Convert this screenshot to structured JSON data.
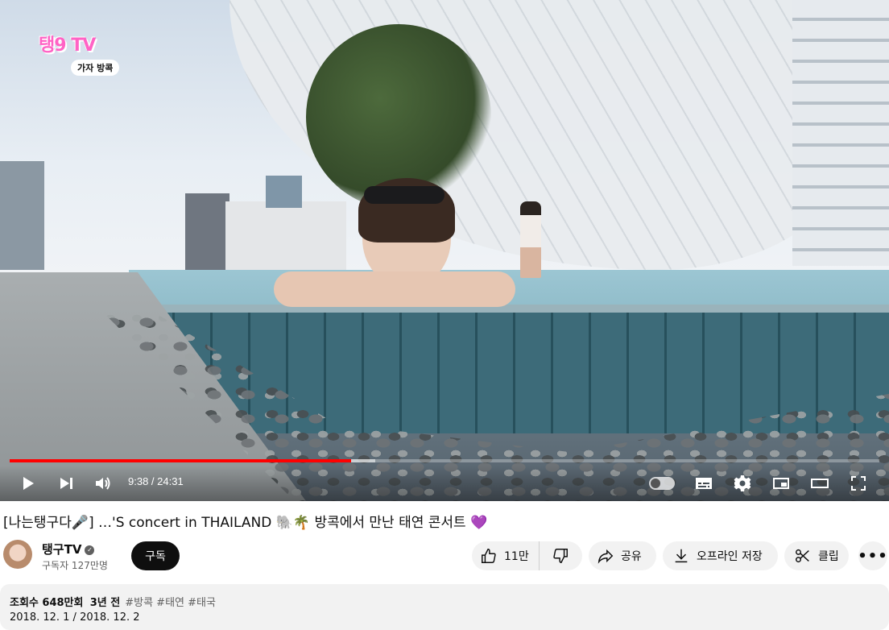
{
  "player": {
    "overlay_logo": "탱9 TV",
    "overlay_tag": "가자 방콕",
    "time_display": "9:38 / 24:31",
    "progress_played_fraction": 0.393,
    "progress_buffered_fraction": 0.42,
    "controls": {
      "play_icon": "play-icon",
      "next_icon": "next-icon",
      "volume_icon": "volume-icon",
      "autoplay_toggle": "autoplay-toggle",
      "subtitles_icon": "subtitles-icon",
      "settings_icon": "gear-icon",
      "miniplayer_icon": "miniplayer-icon",
      "theater_icon": "theater-icon",
      "fullscreen_icon": "fullscreen-icon"
    }
  },
  "video": {
    "title": "[나는탱구다🎤] …'S concert in THAILAND 🐘🌴 방콕에서 만난 태연 콘서트 💜"
  },
  "channel": {
    "name": "탱구TV",
    "subscribers": "구독자 127만명",
    "subscribe_label": "구독"
  },
  "actions": {
    "like_count": "11만",
    "share_label": "공유",
    "offline_label": "오프라인 저장",
    "clip_label": "클립",
    "more_label": "•••"
  },
  "description": {
    "views": "조회수 648만회",
    "age": "3년 전",
    "tags": "#방콕 #태연 #태국",
    "dates": "2018. 12. 1 / 2018. 12. 2"
  }
}
